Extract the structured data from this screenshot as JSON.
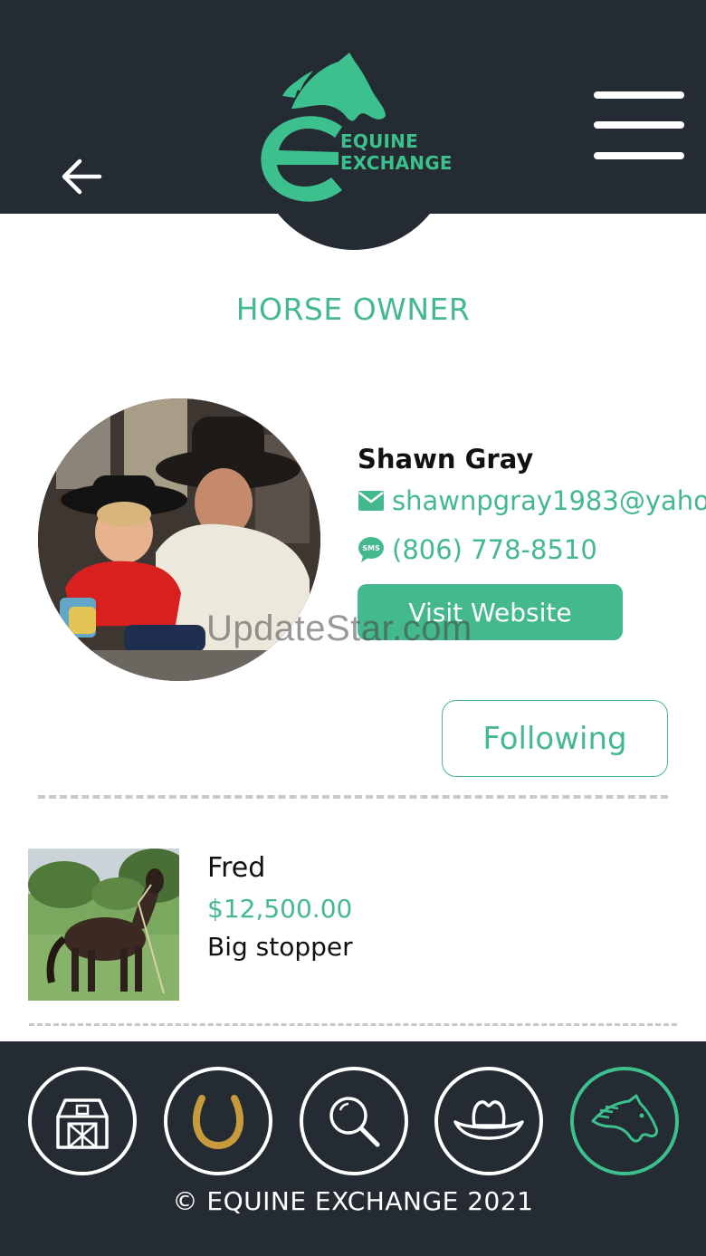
{
  "header": {
    "back_icon": "arrow-left-icon",
    "menu_icon": "hamburger-menu-icon",
    "logo_line1": "EQUINE",
    "logo_line2": "EXCHANGE"
  },
  "section_title": "HORSE OWNER",
  "profile": {
    "name": "Shawn Gray",
    "email": "shawnpgray1983@yaho",
    "phone": "(806) 778-8510",
    "visit_label": "Visit Website",
    "following_label": "Following",
    "email_icon": "envelope-icon",
    "phone_icon": "sms-bubble-icon"
  },
  "watermark": "UpdateStar.com",
  "listings": [
    {
      "name": "Fred",
      "price": "$12,500.00",
      "description": "Big stopper"
    }
  ],
  "footer": {
    "nav": [
      {
        "icon": "barn-icon"
      },
      {
        "icon": "horseshoe-icon"
      },
      {
        "icon": "search-icon"
      },
      {
        "icon": "cowboy-hat-icon"
      },
      {
        "icon": "horse-head-icon",
        "active": true
      }
    ],
    "copyright": "© EQUINE EXCHANGE 2021"
  },
  "colors": {
    "dark": "#252b33",
    "accent": "#45b98e",
    "horseshoe": "#c79a3b"
  }
}
